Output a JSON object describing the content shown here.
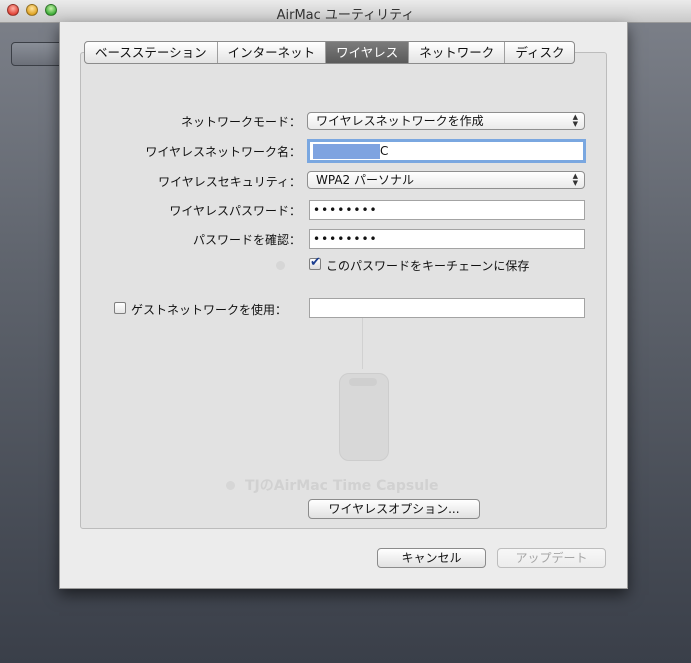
{
  "window": {
    "title": "AirMac ユーティリティ"
  },
  "tabs": [
    {
      "label": "ベースステーション",
      "active": false
    },
    {
      "label": "インターネット",
      "active": false
    },
    {
      "label": "ワイヤレス",
      "active": true
    },
    {
      "label": "ネットワーク",
      "active": false
    },
    {
      "label": "ディスク",
      "active": false
    }
  ],
  "form": {
    "network_mode": {
      "label": "ネットワークモード：",
      "value": "ワイヤレスネットワークを作成"
    },
    "network_name": {
      "label": "ワイヤレスネットワーク名：",
      "value_suffix": "C"
    },
    "security": {
      "label": "ワイヤレスセキュリティ：",
      "value": "WPA2 パーソナル"
    },
    "password": {
      "label": "ワイヤレスパスワード：",
      "value": "••••••••"
    },
    "confirm_password": {
      "label": "パスワードを確認：",
      "value": "••••••••"
    },
    "save_keychain": {
      "label": "このパスワードをキーチェーンに保存",
      "checked": true
    },
    "guest_network": {
      "label": "ゲストネットワークを使用：",
      "checked": false,
      "value": ""
    },
    "wireless_options_button": "ワイヤレスオプション..."
  },
  "background": {
    "device_caption": "TJのAirMac Time Capsule"
  },
  "footer": {
    "cancel": "キャンセル",
    "update": "アップデート"
  }
}
